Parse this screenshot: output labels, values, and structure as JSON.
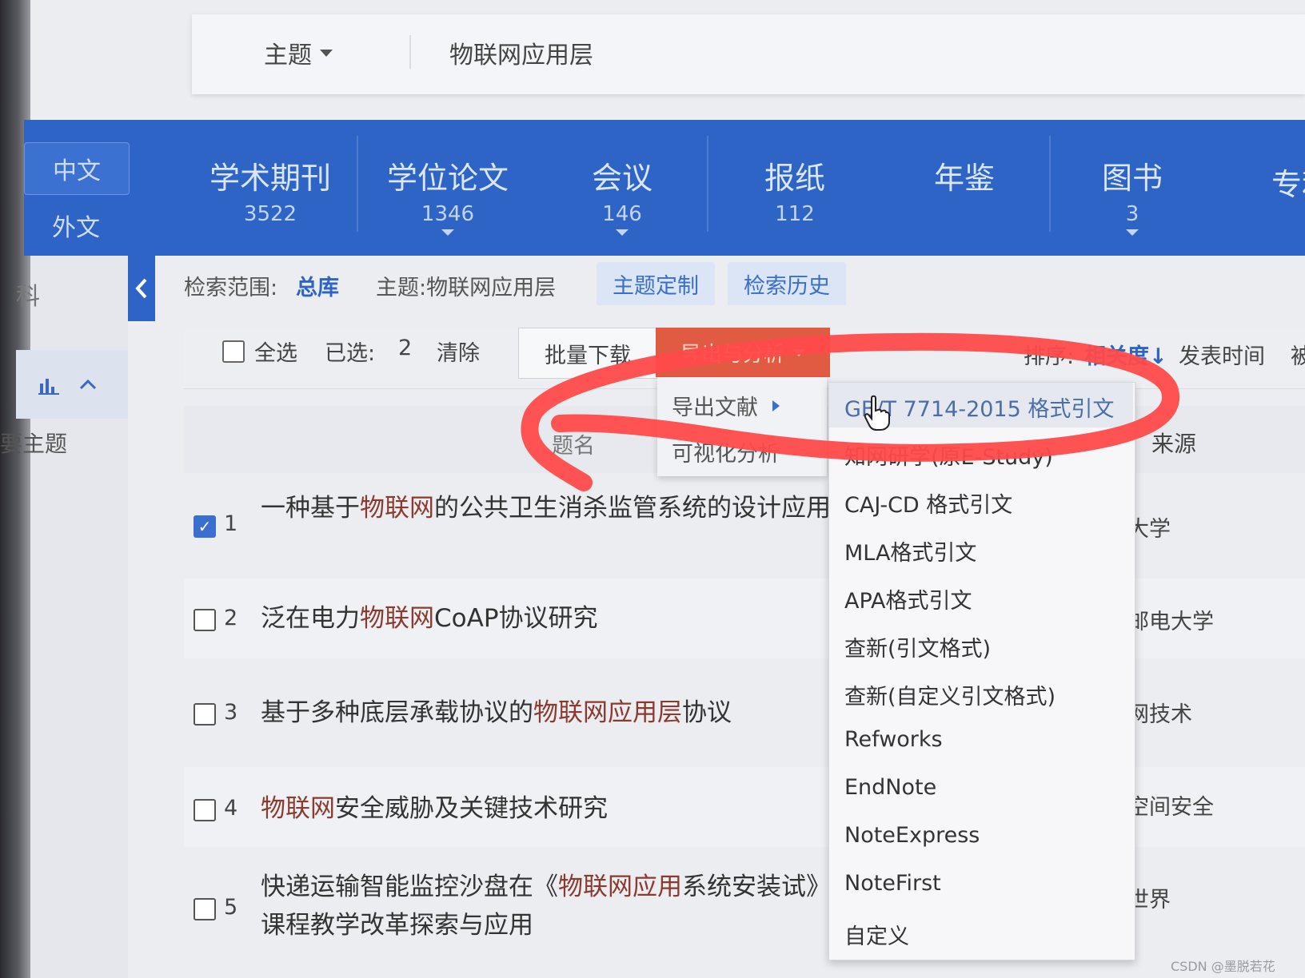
{
  "topbar": {
    "field": "主题",
    "query": "物联网应用层"
  },
  "lang_tabs": [
    "中文",
    "外文"
  ],
  "nav_tabs": [
    {
      "label": "学术期刊",
      "count": "3522"
    },
    {
      "label": "学位论文",
      "count": "1346"
    },
    {
      "label": "会议",
      "count": "146"
    },
    {
      "label": "报纸",
      "count": "112"
    },
    {
      "label": "年鉴",
      "count": ""
    },
    {
      "label": "图书",
      "count": "3"
    },
    {
      "label": "专利",
      "count": ""
    }
  ],
  "sidebar": {
    "item_ke": "科",
    "item_topic": "要主题"
  },
  "scope": {
    "label": "检索范围:",
    "value": "总库",
    "topic": "主题:物联网应用层",
    "custom_btn": "主题定制",
    "history_btn": "检索历史"
  },
  "toolbar": {
    "select_all": "全选",
    "selected_label": "已选:",
    "selected_count": "2",
    "clear": "清除",
    "batch_download": "批量下载",
    "export_analysis": "导出与分析",
    "sort_label": "排序:",
    "sort_relevance": "相关度",
    "sort_date": "发表时间",
    "sort_more": "被"
  },
  "table": {
    "col_title": "题名",
    "col_source": "来源"
  },
  "results": [
    {
      "num": "1",
      "checked": true,
      "pre": "一种基于",
      "hl": "物联网",
      "post": "的公共卫生消杀监管系统的设计应用",
      "source": "大学"
    },
    {
      "num": "2",
      "checked": false,
      "pre": "泛在电力",
      "hl": "物联网",
      "post": "CoAP协议研究",
      "source": "邮电大学"
    },
    {
      "num": "3",
      "checked": false,
      "pre": "基于多种底层承载协议的",
      "hl": "物联网应用层",
      "post": "协议",
      "source": "网技术"
    },
    {
      "num": "4",
      "checked": false,
      "pre": "",
      "hl": "物联网",
      "post": "安全威胁及关键技术研究",
      "source": "空间安全"
    },
    {
      "num": "5",
      "checked": false,
      "pre": "快递运输智能监控沙盘在《",
      "hl": "物联网应用",
      "post": "系统安装试》课程教学改革探索与应用",
      "source": "世界"
    }
  ],
  "export_menu": {
    "item1": "导出文献",
    "item2": "可视化分析"
  },
  "cite_formats": [
    "GB/T 7714-2015 格式引文",
    "知网研学(原E-Study)",
    "CAJ-CD 格式引文",
    "MLA格式引文",
    "APA格式引文",
    "查新(引文格式)",
    "查新(自定义引文格式)",
    "Refworks",
    "EndNote",
    "NoteExpress",
    "NoteFirst",
    "自定义"
  ],
  "watermark": "CSDN @墨脱若花",
  "colors": {
    "nav_blue": "#2d64c5",
    "export_red": "#e15b43",
    "ink_red": "#ff4a4a",
    "highlight": "#8a3a2e"
  }
}
